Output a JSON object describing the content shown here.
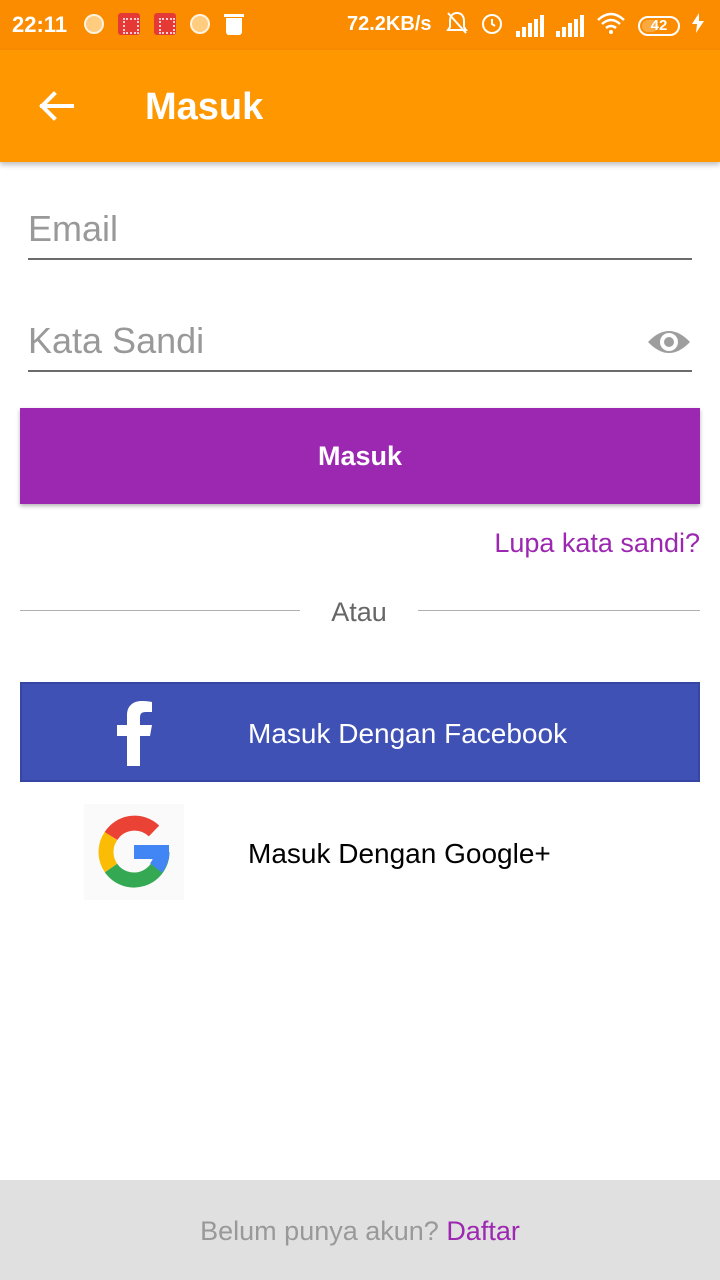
{
  "status_bar": {
    "time": "22:11",
    "network_speed": "72.2KB/s",
    "battery_level": "42",
    "icons": [
      "notification-dot-icon",
      "app-notification-icon",
      "app-notification-icon",
      "notification-dot-icon",
      "trash-icon",
      "bell-off-icon",
      "alarm-icon",
      "signal-hplus-icon",
      "signal-icon",
      "wifi-icon",
      "battery-icon",
      "charging-icon"
    ]
  },
  "app_bar": {
    "title": "Masuk",
    "back_icon": "arrow-left-icon"
  },
  "form": {
    "email_placeholder": "Email",
    "password_placeholder": "Kata Sandi",
    "password_toggle_icon": "eye-icon",
    "login_label": "Masuk",
    "forgot_password": "Lupa kata sandi?",
    "divider_text": "Atau"
  },
  "social": {
    "facebook_label": "Masuk Dengan Facebook",
    "facebook_icon": "facebook-icon",
    "google_label": "Masuk Dengan Google+",
    "google_icon": "google-icon"
  },
  "footer": {
    "prompt": "Belum punya akun?",
    "register_link": "Daftar"
  },
  "colors": {
    "status_bar": "#fb8c00",
    "app_bar": "#ff9800",
    "primary": "#9c27b0",
    "facebook": "#3f51b5",
    "footer_bg": "#e0e0e0"
  }
}
